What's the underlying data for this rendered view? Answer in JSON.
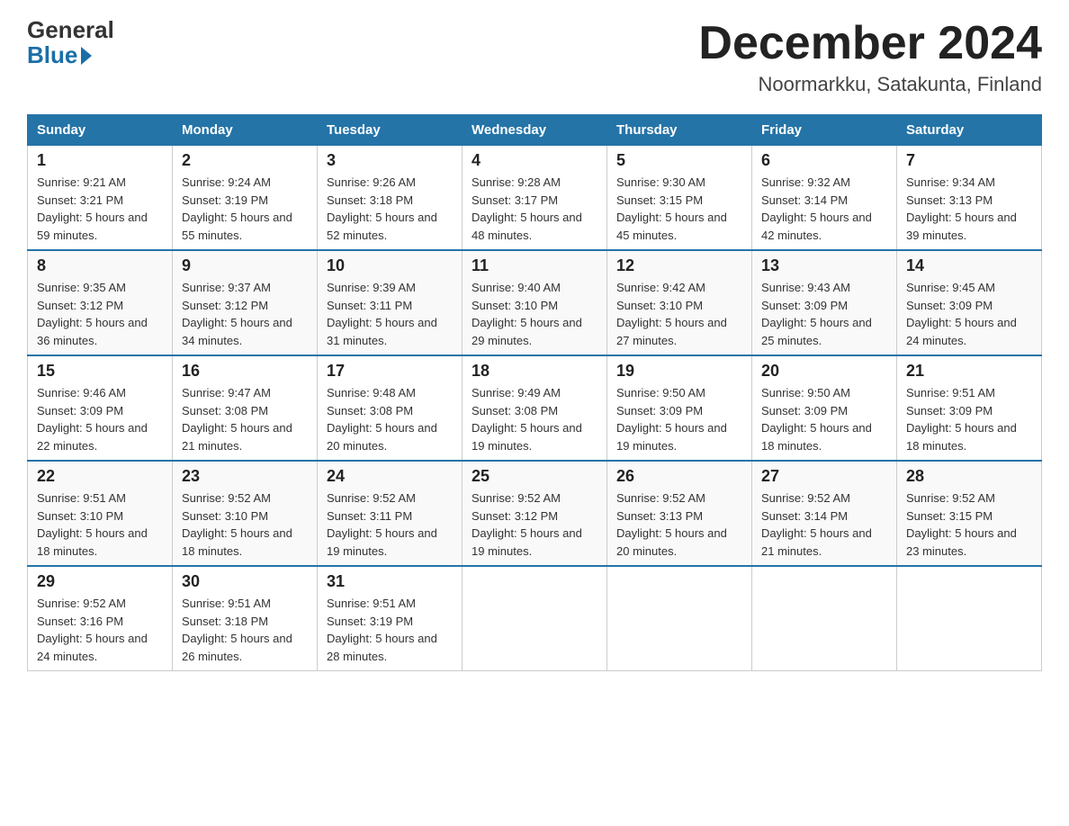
{
  "header": {
    "logo_general": "General",
    "logo_blue": "Blue",
    "month_title": "December 2024",
    "location": "Noormarkku, Satakunta, Finland"
  },
  "days_of_week": [
    "Sunday",
    "Monday",
    "Tuesday",
    "Wednesday",
    "Thursday",
    "Friday",
    "Saturday"
  ],
  "weeks": [
    [
      {
        "day": "1",
        "sunrise": "9:21 AM",
        "sunset": "3:21 PM",
        "daylight": "5 hours and 59 minutes."
      },
      {
        "day": "2",
        "sunrise": "9:24 AM",
        "sunset": "3:19 PM",
        "daylight": "5 hours and 55 minutes."
      },
      {
        "day": "3",
        "sunrise": "9:26 AM",
        "sunset": "3:18 PM",
        "daylight": "5 hours and 52 minutes."
      },
      {
        "day": "4",
        "sunrise": "9:28 AM",
        "sunset": "3:17 PM",
        "daylight": "5 hours and 48 minutes."
      },
      {
        "day": "5",
        "sunrise": "9:30 AM",
        "sunset": "3:15 PM",
        "daylight": "5 hours and 45 minutes."
      },
      {
        "day": "6",
        "sunrise": "9:32 AM",
        "sunset": "3:14 PM",
        "daylight": "5 hours and 42 minutes."
      },
      {
        "day": "7",
        "sunrise": "9:34 AM",
        "sunset": "3:13 PM",
        "daylight": "5 hours and 39 minutes."
      }
    ],
    [
      {
        "day": "8",
        "sunrise": "9:35 AM",
        "sunset": "3:12 PM",
        "daylight": "5 hours and 36 minutes."
      },
      {
        "day": "9",
        "sunrise": "9:37 AM",
        "sunset": "3:12 PM",
        "daylight": "5 hours and 34 minutes."
      },
      {
        "day": "10",
        "sunrise": "9:39 AM",
        "sunset": "3:11 PM",
        "daylight": "5 hours and 31 minutes."
      },
      {
        "day": "11",
        "sunrise": "9:40 AM",
        "sunset": "3:10 PM",
        "daylight": "5 hours and 29 minutes."
      },
      {
        "day": "12",
        "sunrise": "9:42 AM",
        "sunset": "3:10 PM",
        "daylight": "5 hours and 27 minutes."
      },
      {
        "day": "13",
        "sunrise": "9:43 AM",
        "sunset": "3:09 PM",
        "daylight": "5 hours and 25 minutes."
      },
      {
        "day": "14",
        "sunrise": "9:45 AM",
        "sunset": "3:09 PM",
        "daylight": "5 hours and 24 minutes."
      }
    ],
    [
      {
        "day": "15",
        "sunrise": "9:46 AM",
        "sunset": "3:09 PM",
        "daylight": "5 hours and 22 minutes."
      },
      {
        "day": "16",
        "sunrise": "9:47 AM",
        "sunset": "3:08 PM",
        "daylight": "5 hours and 21 minutes."
      },
      {
        "day": "17",
        "sunrise": "9:48 AM",
        "sunset": "3:08 PM",
        "daylight": "5 hours and 20 minutes."
      },
      {
        "day": "18",
        "sunrise": "9:49 AM",
        "sunset": "3:08 PM",
        "daylight": "5 hours and 19 minutes."
      },
      {
        "day": "19",
        "sunrise": "9:50 AM",
        "sunset": "3:09 PM",
        "daylight": "5 hours and 19 minutes."
      },
      {
        "day": "20",
        "sunrise": "9:50 AM",
        "sunset": "3:09 PM",
        "daylight": "5 hours and 18 minutes."
      },
      {
        "day": "21",
        "sunrise": "9:51 AM",
        "sunset": "3:09 PM",
        "daylight": "5 hours and 18 minutes."
      }
    ],
    [
      {
        "day": "22",
        "sunrise": "9:51 AM",
        "sunset": "3:10 PM",
        "daylight": "5 hours and 18 minutes."
      },
      {
        "day": "23",
        "sunrise": "9:52 AM",
        "sunset": "3:10 PM",
        "daylight": "5 hours and 18 minutes."
      },
      {
        "day": "24",
        "sunrise": "9:52 AM",
        "sunset": "3:11 PM",
        "daylight": "5 hours and 19 minutes."
      },
      {
        "day": "25",
        "sunrise": "9:52 AM",
        "sunset": "3:12 PM",
        "daylight": "5 hours and 19 minutes."
      },
      {
        "day": "26",
        "sunrise": "9:52 AM",
        "sunset": "3:13 PM",
        "daylight": "5 hours and 20 minutes."
      },
      {
        "day": "27",
        "sunrise": "9:52 AM",
        "sunset": "3:14 PM",
        "daylight": "5 hours and 21 minutes."
      },
      {
        "day": "28",
        "sunrise": "9:52 AM",
        "sunset": "3:15 PM",
        "daylight": "5 hours and 23 minutes."
      }
    ],
    [
      {
        "day": "29",
        "sunrise": "9:52 AM",
        "sunset": "3:16 PM",
        "daylight": "5 hours and 24 minutes."
      },
      {
        "day": "30",
        "sunrise": "9:51 AM",
        "sunset": "3:18 PM",
        "daylight": "5 hours and 26 minutes."
      },
      {
        "day": "31",
        "sunrise": "9:51 AM",
        "sunset": "3:19 PM",
        "daylight": "5 hours and 28 minutes."
      },
      null,
      null,
      null,
      null
    ]
  ],
  "colors": {
    "header_bg": "#2474a8",
    "header_text": "#ffffff",
    "border": "#cccccc"
  }
}
